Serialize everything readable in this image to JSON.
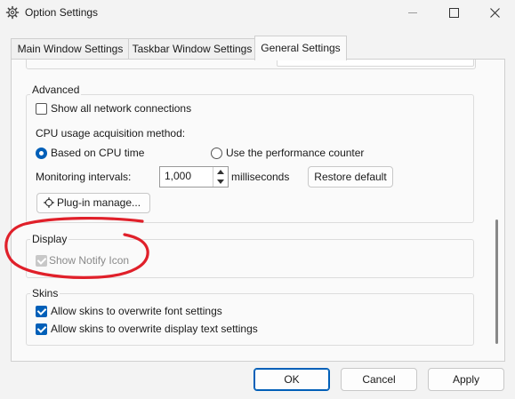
{
  "window": {
    "title": "Option Settings",
    "icon": "gear-icon"
  },
  "tabs": [
    {
      "label": "Main Window Settings",
      "active": false
    },
    {
      "label": "Taskbar Window Settings",
      "active": false
    },
    {
      "label": "General Settings",
      "active": true
    }
  ],
  "advanced": {
    "title": "Advanced",
    "show_all_network": {
      "label": "Show all network connections",
      "checked": false
    },
    "cpu_method_label": "CPU usage acquisition method:",
    "radio_cpu_time": {
      "label": "Based on CPU time",
      "checked": true
    },
    "radio_perf_counter": {
      "label": "Use the performance counter",
      "checked": false
    },
    "monitoring_label": "Monitoring intervals:",
    "monitoring_value": "1,000",
    "monitoring_unit": "milliseconds",
    "restore_default": "Restore default",
    "plugin_manage": "Plug-in manage..."
  },
  "display": {
    "title": "Display",
    "show_notify_icon": {
      "label": "Show Notify Icon",
      "checked": true,
      "disabled": true
    }
  },
  "skins": {
    "title": "Skins",
    "overwrite_font": {
      "label": "Allow skins to overwrite font settings",
      "checked": true
    },
    "overwrite_text": {
      "label": "Allow skins to overwrite display text settings",
      "checked": true
    }
  },
  "buttons": {
    "ok": "OK",
    "cancel": "Cancel",
    "apply": "Apply"
  },
  "colors": {
    "accent": "#005fb8",
    "annotation": "#e0202a"
  }
}
